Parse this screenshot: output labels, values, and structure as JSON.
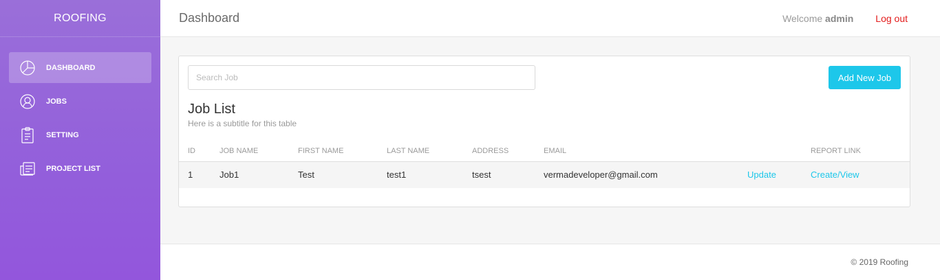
{
  "sidebar": {
    "brand": "ROOFING",
    "items": [
      {
        "label": "DASHBOARD",
        "icon": "pie-chart-icon",
        "active": true
      },
      {
        "label": "JOBS",
        "icon": "user-icon",
        "active": false
      },
      {
        "label": "SETTING",
        "icon": "clipboard-icon",
        "active": false
      },
      {
        "label": "PROJECT LIST",
        "icon": "news-icon",
        "active": false
      }
    ]
  },
  "header": {
    "title": "Dashboard",
    "welcome_prefix": "Welcome",
    "username": "admin",
    "logout_label": "Log out"
  },
  "main": {
    "search_placeholder": "Search Job",
    "add_button_label": "Add New Job",
    "table_title": "Job List",
    "table_subtitle": "Here is a subtitle for this table",
    "columns": [
      "ID",
      "JOB NAME",
      "FIRST NAME",
      "LAST NAME",
      "ADDRESS",
      "EMAIL",
      "",
      "REPORT LINK"
    ],
    "rows": [
      {
        "id": "1",
        "job_name": "Job1",
        "first_name": "Test",
        "last_name": "test1",
        "address": "tsest",
        "email": "vermadeveloper@gmail.com",
        "update_label": "Update",
        "report_label": "Create/View"
      }
    ]
  },
  "footer": {
    "copyright": "© 2019 Roofing"
  },
  "colors": {
    "sidebar_top": "#9a6fd9",
    "sidebar_bottom": "#9356dc",
    "accent": "#1dc7ea",
    "logout": "#e31c1c"
  }
}
